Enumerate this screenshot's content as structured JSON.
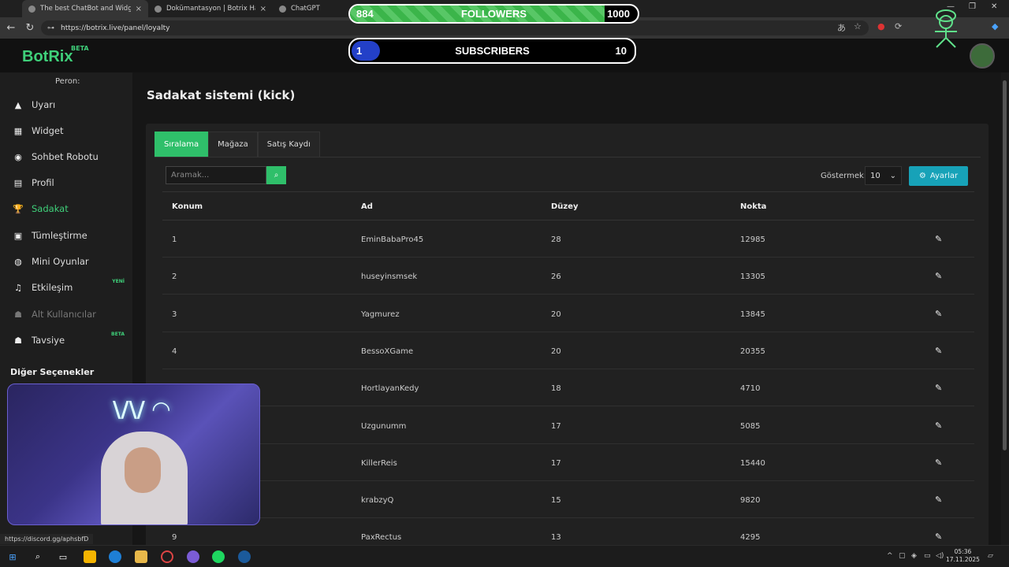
{
  "browser": {
    "tabs": [
      {
        "label": "The best ChatBot and Widgets for",
        "active": true
      },
      {
        "label": "Dokümantasyon | Botrix Hakkında",
        "active": false
      },
      {
        "label": "ChatGPT",
        "active": false
      }
    ],
    "url": "https://botrix.live/panel/loyalty"
  },
  "overlay": {
    "followers": {
      "current": "884",
      "label": "FOLLOWERS",
      "goal": "1000",
      "progress": 0.884
    },
    "subscribers": {
      "current": "1",
      "label": "SUBSCRIBERS",
      "goal": "10",
      "progress": 0.1
    }
  },
  "site": {
    "logo": "BotRix",
    "beta": "BETA"
  },
  "sidebar": {
    "title": "Peron:",
    "items": [
      {
        "label": "Uyarı",
        "icon": "warning-icon",
        "state": "normal",
        "badge": ""
      },
      {
        "label": "Widget",
        "icon": "grid-icon",
        "state": "normal",
        "badge": ""
      },
      {
        "label": "Sohbet Robotu",
        "icon": "robot-icon",
        "state": "normal",
        "badge": ""
      },
      {
        "label": "Profil",
        "icon": "id-card-icon",
        "state": "normal",
        "badge": ""
      },
      {
        "label": "Sadakat",
        "icon": "trophy-icon",
        "state": "active",
        "badge": ""
      },
      {
        "label": "Tümleştirme",
        "icon": "integration-icon",
        "state": "normal",
        "badge": ""
      },
      {
        "label": "Mini Oyunlar",
        "icon": "gamepad-icon",
        "state": "normal",
        "badge": ""
      },
      {
        "label": "Etkileşim",
        "icon": "music-icon",
        "state": "normal",
        "badge": "YENİ"
      },
      {
        "label": "Alt Kullanıcılar",
        "icon": "users-icon",
        "state": "disabled",
        "badge": ""
      },
      {
        "label": "Tavsiye",
        "icon": "user-group-icon",
        "state": "normal",
        "badge": "BETA"
      }
    ],
    "other_options": "Diğer Seçenekler"
  },
  "page": {
    "title": "Sadakat sistemi (kick)",
    "tabs": [
      "Sıralama",
      "Mağaza",
      "Satış Kaydı"
    ],
    "search_placeholder": "Aramak...",
    "show_label": "Göstermek:",
    "show_value": "10",
    "settings_label": "Ayarlar",
    "columns": [
      "Konum",
      "Ad",
      "Düzey",
      "Nokta"
    ],
    "rows": [
      {
        "pos": "1",
        "name": "EminBabaPro45",
        "level": "28",
        "points": "12985"
      },
      {
        "pos": "2",
        "name": "huseyinsmsek",
        "level": "26",
        "points": "13305"
      },
      {
        "pos": "3",
        "name": "Yagmurez",
        "level": "20",
        "points": "13845"
      },
      {
        "pos": "4",
        "name": "BessoXGame",
        "level": "20",
        "points": "20355"
      },
      {
        "pos": "",
        "name": "HortlayanKedy",
        "level": "18",
        "points": "4710"
      },
      {
        "pos": "",
        "name": "Uzgunumm",
        "level": "17",
        "points": "5085"
      },
      {
        "pos": "",
        "name": "KillerReis",
        "level": "17",
        "points": "15440"
      },
      {
        "pos": "",
        "name": "krabzyQ",
        "level": "15",
        "points": "9820"
      },
      {
        "pos": "9",
        "name": "PaxRectus",
        "level": "13",
        "points": "4295"
      }
    ]
  },
  "status_link": "https://discord.gg/aphsbfD",
  "taskbar": {
    "time": "05:36",
    "date": "17.11.2025"
  }
}
